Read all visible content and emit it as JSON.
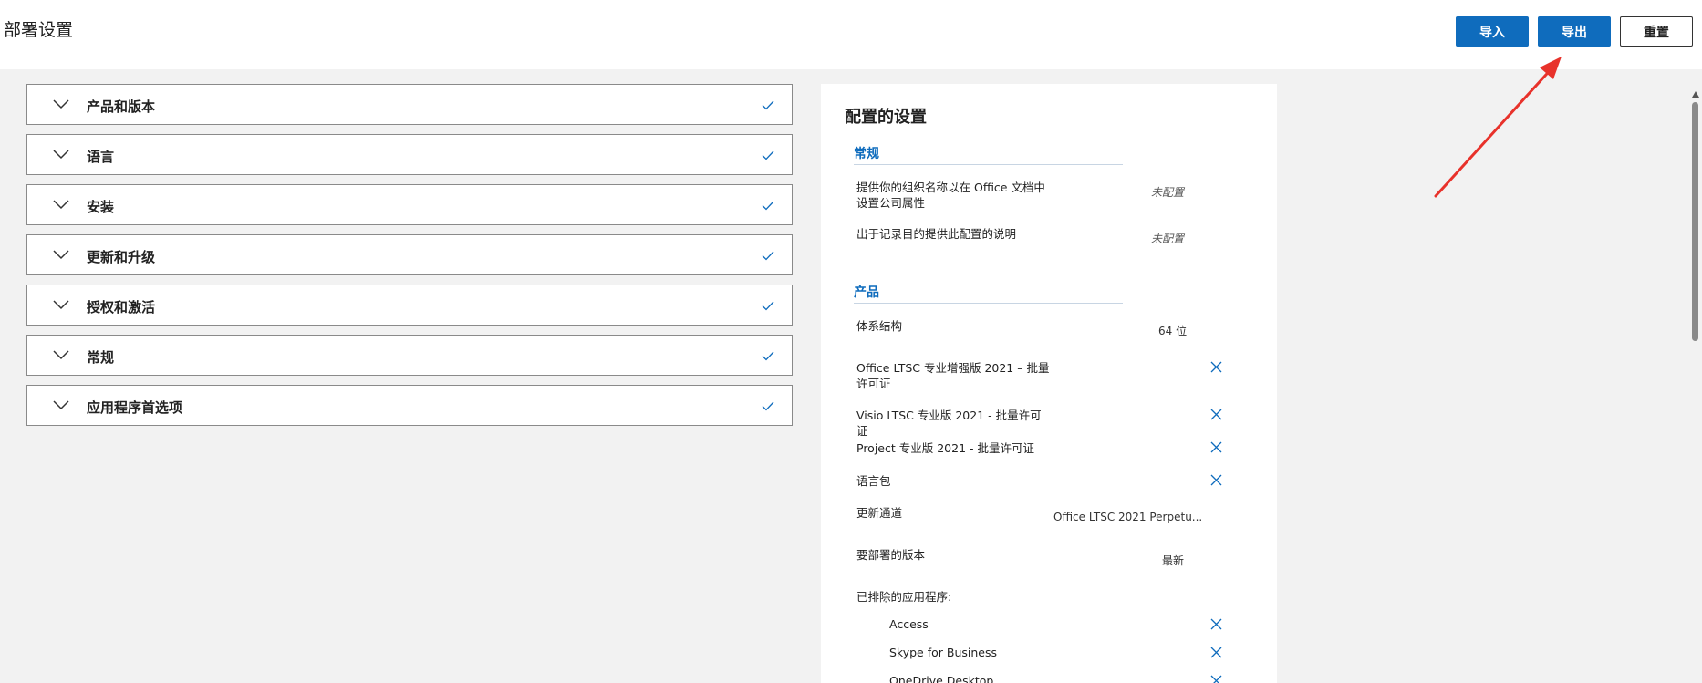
{
  "header": {
    "title": "部署设置",
    "import_label": "导入",
    "export_label": "导出",
    "reset_label": "重置"
  },
  "accordion": [
    {
      "label": "产品和版本"
    },
    {
      "label": "语言"
    },
    {
      "label": "安装"
    },
    {
      "label": "更新和升级"
    },
    {
      "label": "授权和激活"
    },
    {
      "label": "常规"
    },
    {
      "label": "应用程序首选项"
    }
  ],
  "summary": {
    "title": "配置的设置",
    "general": {
      "header": "常规",
      "rows": [
        {
          "label": "提供你的组织名称以在 Office 文档中设置公司属性",
          "value": "未配置"
        },
        {
          "label": "出于记录目的提供此配置的说明",
          "value": "未配置"
        }
      ]
    },
    "product": {
      "header": "产品",
      "architecture": {
        "label": "体系结构",
        "value": "64 位"
      },
      "products": [
        {
          "label": "Office LTSC 专业增强版 2021 – 批量许可证"
        },
        {
          "label": "Visio LTSC 专业版 2021 - 批量许可证"
        },
        {
          "label": "Project 专业版 2021 - 批量许可证"
        },
        {
          "label": "语言包"
        }
      ],
      "update_channel": {
        "label": "更新通道",
        "value": "Office LTSC 2021 Perpetu..."
      },
      "version": {
        "label": "要部署的版本",
        "value": "最新"
      },
      "excluded": {
        "label": "已排除的应用程序:",
        "apps": [
          "Access",
          "Skype for Business",
          "OneDrive Desktop"
        ]
      }
    }
  },
  "colors": {
    "accent": "#0f6cbd",
    "annotation_arrow": "#e8322b"
  }
}
